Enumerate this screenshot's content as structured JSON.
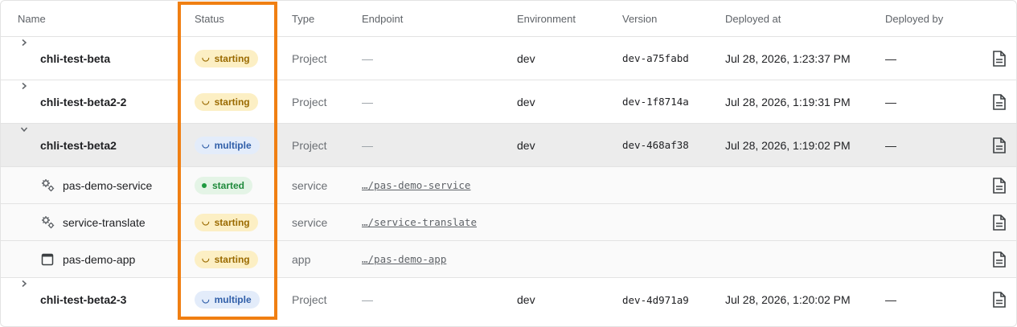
{
  "columns": [
    "Name",
    "Status",
    "Type",
    "Endpoint",
    "Environment",
    "Version",
    "Deployed at",
    "Deployed by"
  ],
  "colors": {
    "accent_outline": "#f07f12",
    "starting": "#fcefc4",
    "multiple": "#e3ecfa",
    "started": "#e4f4e6"
  },
  "rows": [
    {
      "name": "chli-test-beta",
      "status": "starting",
      "type": "Project",
      "endpoint": "—",
      "environment": "dev",
      "version": "dev-a75fabd",
      "deployed_at": "Jul 28, 2026, 1:23:37 PM",
      "deployed_by": "—",
      "expanded": false
    },
    {
      "name": "chli-test-beta2-2",
      "status": "starting",
      "type": "Project",
      "endpoint": "—",
      "environment": "dev",
      "version": "dev-1f8714a",
      "deployed_at": "Jul 28, 2026, 1:19:31 PM",
      "deployed_by": "—",
      "expanded": false
    },
    {
      "name": "chli-test-beta2",
      "status": "multiple",
      "type": "Project",
      "endpoint": "—",
      "environment": "dev",
      "version": "dev-468af38",
      "deployed_at": "Jul 28, 2026, 1:19:02 PM",
      "deployed_by": "—",
      "expanded": true
    },
    {
      "name": "pas-demo-service",
      "status": "started",
      "type": "service",
      "endpoint": "…/pas-demo-service",
      "icon": "gears-icon"
    },
    {
      "name": "service-translate",
      "status": "starting",
      "type": "service",
      "endpoint": "…/service-translate",
      "icon": "gears-icon"
    },
    {
      "name": "pas-demo-app",
      "status": "starting",
      "type": "app",
      "endpoint": "…/pas-demo-app",
      "icon": "app-window-icon"
    },
    {
      "name": "chli-test-beta2-3",
      "status": "multiple",
      "type": "Project",
      "endpoint": "—",
      "environment": "dev",
      "version": "dev-4d971a9",
      "deployed_at": "Jul 28, 2026, 1:20:02 PM",
      "deployed_by": "—",
      "expanded": false
    }
  ]
}
